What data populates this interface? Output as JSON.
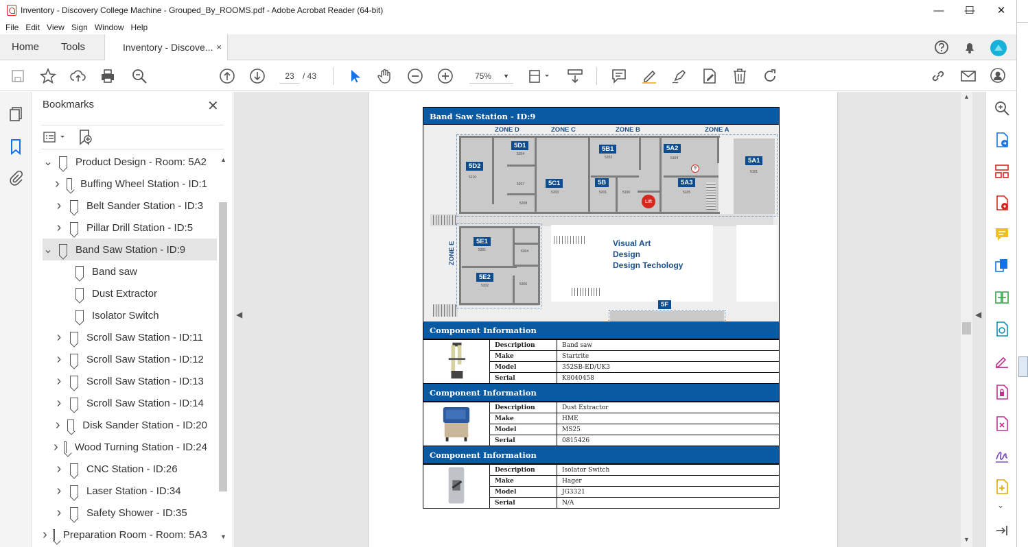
{
  "window": {
    "title": "Inventory - Discovery College Machine - Grouped_By_ROOMS.pdf - Adobe Acrobat Reader (64-bit)",
    "minimize": "—",
    "maximize": "☐",
    "close": "✕"
  },
  "menu": [
    "File",
    "Edit",
    "View",
    "Sign",
    "Window",
    "Help"
  ],
  "tabs": {
    "home": "Home",
    "tools": "Tools",
    "document": "Inventory - Discove...",
    "close": "×"
  },
  "toolbar": {
    "page_current": "23",
    "page_total": "/ 43",
    "zoom": "75%"
  },
  "bookmarks": {
    "title": "Bookmarks",
    "close": "✕",
    "items": [
      {
        "label": "Product Design - Room: 5A2",
        "level": 0,
        "expanded": true
      },
      {
        "label": "Buffing Wheel Station - ID:1",
        "level": 1,
        "expanded": false
      },
      {
        "label": "Belt Sander Station - ID:3",
        "level": 1,
        "expanded": false
      },
      {
        "label": "Pillar Drill Station - ID:5",
        "level": 1,
        "expanded": false
      },
      {
        "label": "Band Saw Station - ID:9",
        "level": 1,
        "expanded": true,
        "selected": true
      },
      {
        "label": "Band saw",
        "level": 2
      },
      {
        "label": "Dust Extractor",
        "level": 2
      },
      {
        "label": "Isolator Switch",
        "level": 2
      },
      {
        "label": "Scroll Saw Station - ID:11",
        "level": 1,
        "expanded": false
      },
      {
        "label": "Scroll Saw Station - ID:12",
        "level": 1,
        "expanded": false
      },
      {
        "label": "Scroll Saw Station - ID:13",
        "level": 1,
        "expanded": false
      },
      {
        "label": "Scroll Saw Station - ID:14",
        "level": 1,
        "expanded": false
      },
      {
        "label": "Disk Sander Station - ID:20",
        "level": 1,
        "expanded": false
      },
      {
        "label": "Wood Turning Station - ID:24",
        "level": 1,
        "expanded": false
      },
      {
        "label": "CNC Station - ID:26",
        "level": 1,
        "expanded": false
      },
      {
        "label": "Laser Station - ID:34",
        "level": 1,
        "expanded": false
      },
      {
        "label": "Safety Shower - ID:35",
        "level": 1,
        "expanded": false
      },
      {
        "label": "Preparation Room - Room: 5A3",
        "level": 0,
        "expanded": false
      }
    ]
  },
  "document": {
    "station_header": "Band Saw Station - ID:9",
    "zones": [
      "ZONE D",
      "ZONE C",
      "ZONE B",
      "ZONE A",
      "ZONE E"
    ],
    "rooms": [
      "5D1",
      "5D2",
      "5C1",
      "5B1",
      "5B",
      "5A2",
      "5A3",
      "5A1",
      "5E1",
      "5E2",
      "5F"
    ],
    "room_numbers": [
      "5204",
      "5210",
      "5207",
      "5208",
      "5203",
      "5202",
      "5201",
      "5100",
      "5104",
      "5105",
      "5101",
      "5301",
      "5304",
      "5302",
      "5306"
    ],
    "marker": "9",
    "lift": "Lift",
    "area_text": [
      "Visual Art",
      "Design",
      "Design Techology"
    ],
    "components": [
      {
        "header": "Component Information",
        "image": "band-saw",
        "rows": [
          [
            "Description",
            "Band saw"
          ],
          [
            "Make",
            "Startrite"
          ],
          [
            "Model",
            "352SB-ED/UK3"
          ],
          [
            "Serial",
            "K8040458"
          ]
        ]
      },
      {
        "header": "Component Information",
        "image": "dust-extractor",
        "rows": [
          [
            "Description",
            "Dust Extractor"
          ],
          [
            "Make",
            "HME"
          ],
          [
            "Model",
            "MS25"
          ],
          [
            "Serial",
            "0815426"
          ]
        ]
      },
      {
        "header": "Component Information",
        "image": "isolator-switch",
        "rows": [
          [
            "Description",
            "Isolator Switch"
          ],
          [
            "Make",
            "Hager"
          ],
          [
            "Model",
            "JG3321"
          ],
          [
            "Serial",
            "N/A"
          ]
        ]
      }
    ]
  },
  "colors": {
    "accent": "#0a5aa3",
    "room_label": "#0d4c8e",
    "lift": "#d7261e"
  }
}
